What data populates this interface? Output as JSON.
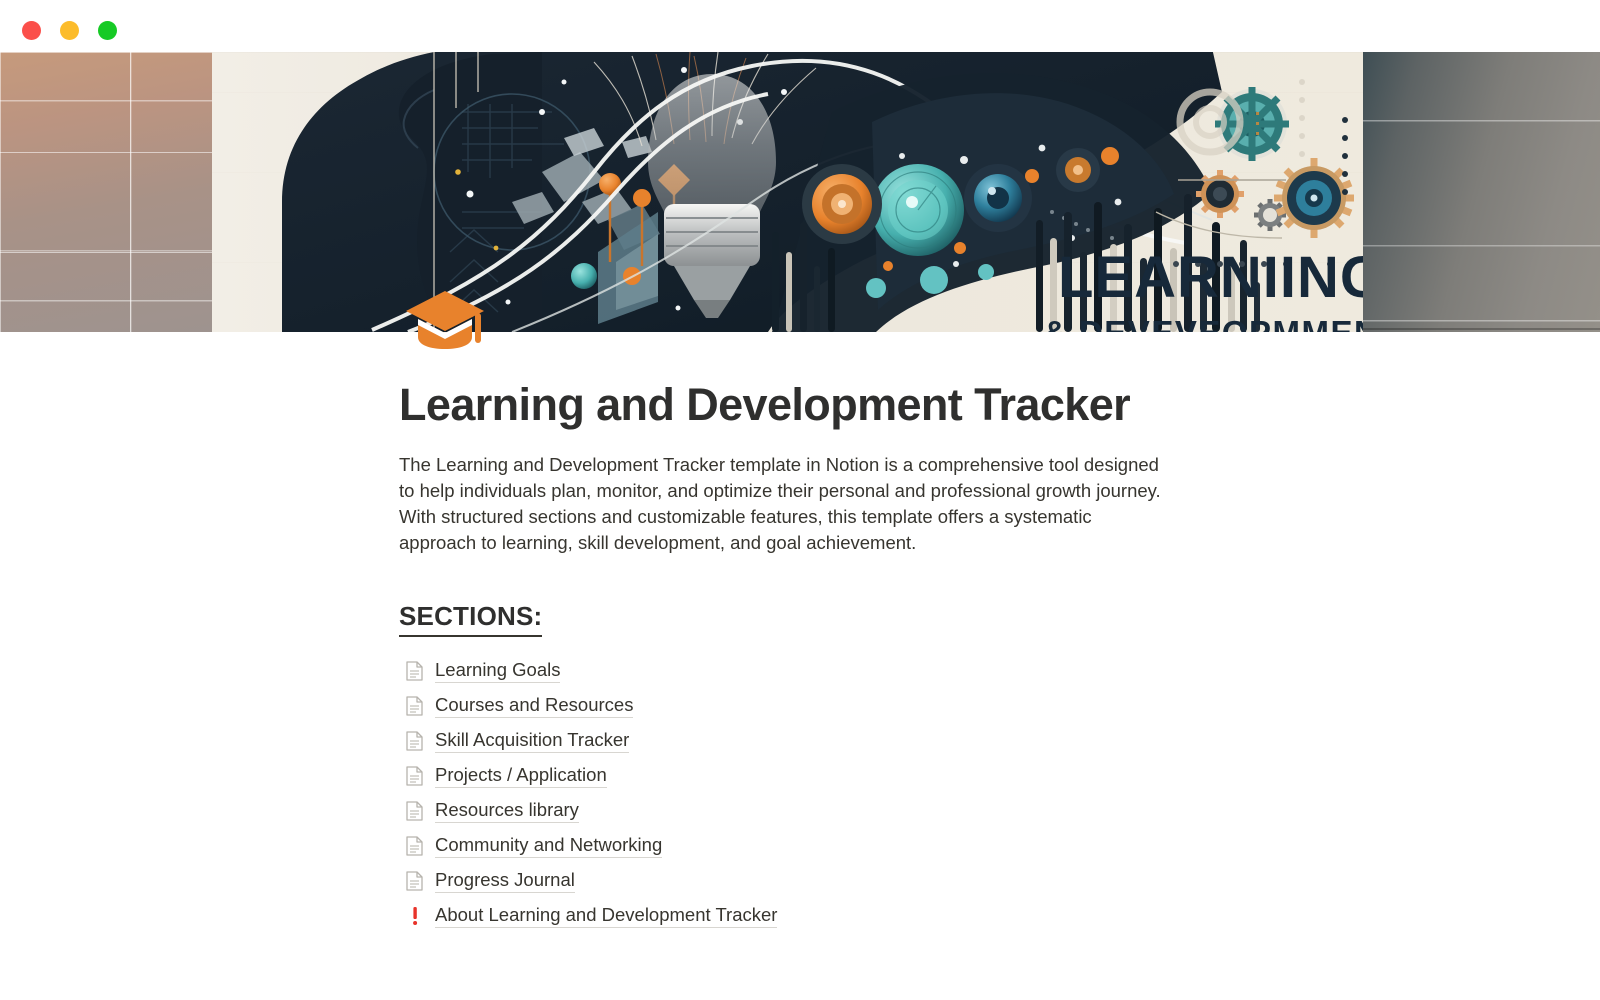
{
  "window": {
    "controls": [
      {
        "name": "close",
        "color": "#fb4f4a"
      },
      {
        "name": "minimize",
        "color": "#fcbc2b"
      },
      {
        "name": "maximize",
        "color": "#16ca25"
      }
    ]
  },
  "cover": {
    "alt": "learning-and-development-abstract-banner",
    "headline": "LEARNIING",
    "subheadline": "& DEVEVEOPMMENT",
    "colors": {
      "paper": "#ece7dd",
      "ink": "#1e2a38",
      "accent_orange": "#e8822c",
      "accent_teal": "#63c2c2",
      "accent_steel": "#9fb3bd"
    }
  },
  "page": {
    "icon": "graduation-cap-icon",
    "icon_color": "#e8822c",
    "title": "Learning and Development Tracker",
    "intro": "The Learning and Development Tracker template in Notion is a comprehensive tool designed to help individuals plan, monitor, and optimize their personal and professional growth journey. With structured sections and customizable features, this template offers a systematic approach to learning, skill development, and goal achievement.",
    "sections_heading": "SECTIONS:",
    "sections": [
      {
        "icon": "document-icon",
        "label": "Learning Goals"
      },
      {
        "icon": "document-icon",
        "label": "Courses and Resources"
      },
      {
        "icon": "document-icon",
        "label": "Skill Acquisition Tracker"
      },
      {
        "icon": "document-icon",
        "label": "Projects / Application"
      },
      {
        "icon": "document-icon",
        "label": "Resources library"
      },
      {
        "icon": "document-icon",
        "label": "Community and Networking"
      },
      {
        "icon": "document-icon",
        "label": "Progress Journal"
      },
      {
        "icon": "exclamation-mark-icon",
        "label": "About Learning and Development Tracker"
      }
    ]
  }
}
